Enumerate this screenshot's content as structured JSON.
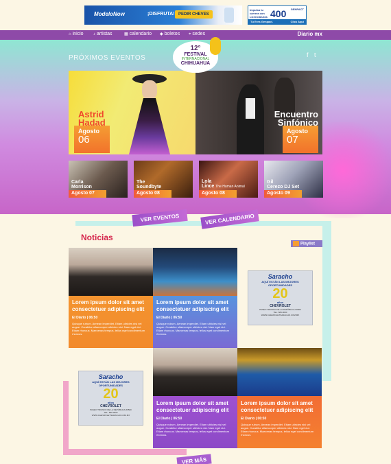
{
  "ads": {
    "top_left": {
      "brand": "ModeloNow",
      "tagline": "¡DISFRUTA!",
      "button": "PEDIR CHEVES"
    },
    "top_right": {
      "text": "Impulsa tu carrera con Licenciaturas en ingeniería",
      "number": "400",
      "brand": "GENPACT",
      "footer": "Tú Eres Genpact.",
      "cta": "Click Aquí"
    }
  },
  "nav": {
    "items": [
      {
        "icon": "⌂",
        "label": "inicio"
      },
      {
        "icon": "♪",
        "label": "artistas"
      },
      {
        "icon": "▦",
        "label": "calendario"
      },
      {
        "icon": "◆",
        "label": "boletos"
      },
      {
        "icon": "⌖",
        "label": "sedes"
      }
    ],
    "brand": "Diario mx"
  },
  "hero": {
    "section_title": "PRÓXIMOS EVENTOS",
    "social": {
      "facebook": "f",
      "twitter": "t"
    },
    "logo": {
      "number": "12°",
      "name": "FESTIVAL",
      "sub": "INTERNACIONAL",
      "city": "CHIHUAHUA"
    },
    "featured": [
      {
        "name_line1": "Astrid",
        "name_line2": "Hadad",
        "month": "Agosto",
        "day": "06"
      },
      {
        "name_line1": "Encuentro",
        "name_line2": "Sinfónico",
        "month": "Agosto",
        "day": "07"
      }
    ],
    "small": [
      {
        "name_line1": "Carla",
        "name_line2": "Morrison",
        "date": "Agosto 07"
      },
      {
        "name_line1": "The",
        "name_line2": "Soundbyte",
        "date": "Agosto 08"
      },
      {
        "name_line1": "Lola",
        "name_line2": "Lince",
        "sub": "The Human Animal",
        "date": "Agosto 08"
      },
      {
        "name_line1": "Gil",
        "name_line2": "Cerezo DJ Set",
        "date": "Agosto 09"
      }
    ],
    "buttons": {
      "events": "VER EVENTOS",
      "calendar": "VER CALENDARIO"
    }
  },
  "news": {
    "title": "Noticias",
    "playlist": "Playlist",
    "cards": [
      {
        "headline": "Lorem ipsum dolor sit amet consectetuer adipiscing elit",
        "source": "El Diario | 06:50",
        "body": "Quisque rutrum. Aenean imperdiet. Etiam ultricies nisi vel augue. Curabitur ullamcorper ultricies nisi. Nam eget dui. Etiam rhoncus. Maecenas tempus, tellus eget condimentum rhoncus."
      },
      {
        "headline": "Lorem ipsum dolor sit amet consectetuer adipiscing elit",
        "source": "El Diario | 06:50",
        "body": "Quisque rutrum. Aenean imperdiet. Etiam ultricies nisi vel augue. Curabitur ullamcorper ultricies nisi. Nam eget dui. Etiam rhoncus. Maecenas tempus, tellus eget condimentum rhoncus."
      },
      {
        "headline": "Lorem ipsum dolor sit amet consectetuer adipiscing elit",
        "source": "El Diario | 06:50",
        "body": "Quisque rutrum. Aenean imperdiet. Etiam ultricies nisi vel augue. Curabitur ullamcorper ultricies nisi. Nam eget dui. Etiam rhoncus. Maecenas tempus, tellus eget condimentum rhoncus."
      },
      {
        "headline": "Lorem ipsum dolor sit amet consectetuer adipiscing elit",
        "source": "El Diario | 06:50",
        "body": "Quisque rutrum. Aenean imperdiet. Etiam ultricies nisi vel augue. Curabitur ullamcorper ultricies nisi. Nam eget dui. Etiam rhoncus. Maecenas tempus, tellus eget condimentum rhoncus."
      }
    ],
    "ad": {
      "brand": "Saracho",
      "line1": "AQUÍ ESTÁN LAS MEJORES",
      "line2": "OPORTUNIDADES",
      "years": "20",
      "years_label": "años",
      "make": "CHEVROLET",
      "address": "PASEO TRIUNFO DE LA REPÚBLICA #3500",
      "phone": "TEL. 686-0000",
      "web": "WWW.CHEVROLETSARACHO.COM.MX"
    },
    "more": "VER MÁS"
  },
  "colors": {
    "nav": "#8e4aa8",
    "orange": "#f59d33",
    "accent": "#d5264c",
    "mint": "#c6f0ea"
  }
}
